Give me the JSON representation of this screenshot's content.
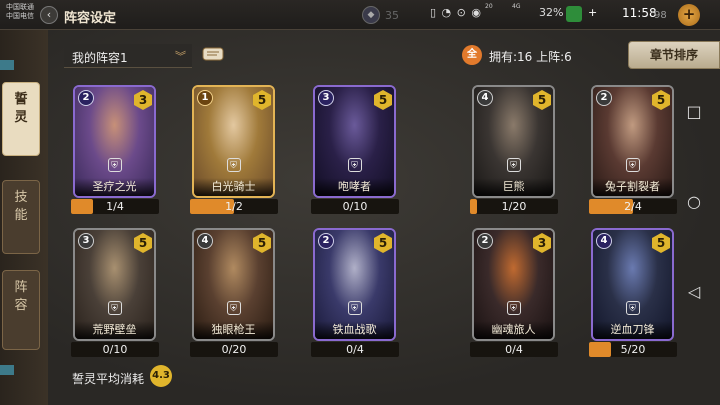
{
  "status": {
    "carrier_line1": "中国联通",
    "carrier_line2": "中国电信",
    "signal": "4G",
    "net_speed": "20",
    "net_speed2": "4G",
    "battery": "32%",
    "time": "11:58",
    "icons": "▯ ◔ ⊙ ◉"
  },
  "header": {
    "title": "阵容设定",
    "resource_value": "35",
    "count": "98"
  },
  "sidebar": {
    "items": [
      {
        "label": "誓灵"
      },
      {
        "label": "技能"
      },
      {
        "label": "阵容"
      }
    ]
  },
  "toolbar": {
    "lineup_name": "我的阵容1",
    "all_label": "全",
    "owned_text": "拥有:16  上阵:6",
    "sort_label": "章节排序"
  },
  "cards": [
    {
      "name": "圣疗之光",
      "cost": "2",
      "stars": "3",
      "progress": "1/4",
      "fill": 0.25,
      "frame": "purple",
      "art": [
        "#6b4a8a",
        "#c79078",
        "#3a2a5a"
      ]
    },
    {
      "name": "白光骑士",
      "cost": "1",
      "stars": "5",
      "progress": "1/2",
      "fill": 0.5,
      "frame": "gold",
      "art": [
        "#a07a3a",
        "#e3c8a0",
        "#6a4a2a"
      ]
    },
    {
      "name": "咆哮者",
      "cost": "3",
      "stars": "5",
      "progress": "0/10",
      "fill": 0.0,
      "frame": "purple",
      "art": [
        "#2a2048",
        "#6a5a9a",
        "#120e24"
      ]
    },
    {
      "name": "巨熊",
      "cost": "4",
      "stars": "5",
      "progress": "1/20",
      "fill": 0.05,
      "frame": "silver",
      "art": [
        "#3a3532",
        "#8a7a6a",
        "#1a1816"
      ]
    },
    {
      "name": "兔子割裂者",
      "cost": "2",
      "stars": "5",
      "progress": "2/4",
      "fill": 0.5,
      "frame": "silver",
      "art": [
        "#5a3a32",
        "#c09a80",
        "#2a1a16"
      ]
    },
    {
      "name": "荒野壁垒",
      "cost": "3",
      "stars": "5",
      "progress": "0/10",
      "fill": 0.0,
      "frame": "silver",
      "art": [
        "#4a4038",
        "#a89070",
        "#2a221c"
      ]
    },
    {
      "name": "独眼枪王",
      "cost": "4",
      "stars": "5",
      "progress": "0/20",
      "fill": 0.0,
      "frame": "silver",
      "art": [
        "#5a4030",
        "#b08a60",
        "#2a1c12"
      ]
    },
    {
      "name": "铁血战歌",
      "cost": "2",
      "stars": "5",
      "progress": "0/4",
      "fill": 0.0,
      "frame": "purple",
      "art": [
        "#3a3a6a",
        "#b0b0c8",
        "#1a1a3a"
      ]
    },
    {
      "name": "幽魂旅人",
      "cost": "2",
      "stars": "3",
      "progress": "0/4",
      "fill": 0.0,
      "frame": "silver",
      "art": [
        "#3a2a2a",
        "#c06a30",
        "#1a1212"
      ]
    },
    {
      "name": "逆血刀锋",
      "cost": "4",
      "stars": "5",
      "progress": "5/20",
      "fill": 0.25,
      "frame": "purple",
      "art": [
        "#2a3048",
        "#6a7ab0",
        "#12162a"
      ]
    }
  ],
  "footer": {
    "avg_label": "誓灵平均消耗",
    "avg_value": "4.3"
  },
  "navbar": {
    "square": "□",
    "circle": "○",
    "back": "◁"
  }
}
